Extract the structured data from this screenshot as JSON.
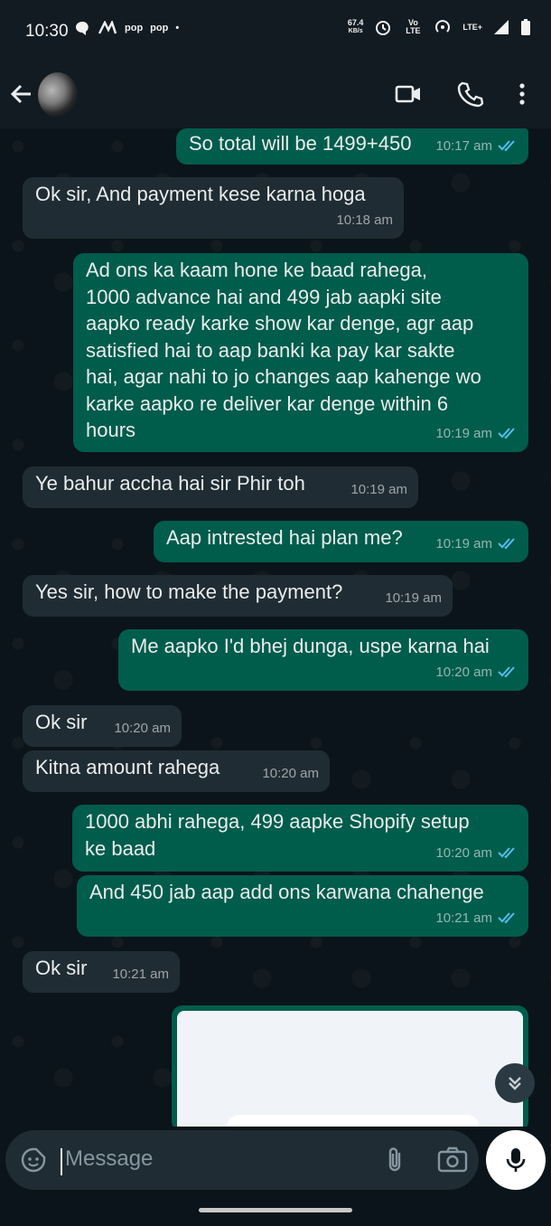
{
  "status_bar": {
    "time": "10:30",
    "badges": [
      "pop",
      "pop"
    ],
    "speed_value": "67.4",
    "speed_unit": "KB/s",
    "volte": "Vo LTE",
    "network": "LTE+"
  },
  "header": {
    "back_icon": "arrow-left-icon",
    "avatar_icon": "contact-avatar",
    "video_icon": "video-call-icon",
    "call_icon": "phone-icon",
    "menu_icon": "more-vert-icon"
  },
  "messages": [
    {
      "dir": "out",
      "text": "So total will be 1499+450",
      "time": "10:17 am",
      "read": true
    },
    {
      "dir": "in",
      "text": "Ok sir, And payment kese karna hoga",
      "time": "10:18 am"
    },
    {
      "dir": "out",
      "text": "Ad ons ka kaam hone ke baad rahega,\n1000 advance hai and 499 jab aapki site\naapko ready karke show kar denge, agr aap\nsatisfied hai to aap banki ka pay kar sakte\nhai, agar nahi to jo changes aap kahenge wo\nkarke aapko re deliver kar denge within 6\nhours",
      "time": "10:19 am",
      "read": true
    },
    {
      "dir": "in",
      "text": "Ye bahur accha hai sir Phir toh",
      "time": "10:19 am"
    },
    {
      "dir": "out",
      "text": "Aap intrested hai plan me?",
      "time": "10:19 am",
      "read": true
    },
    {
      "dir": "in",
      "text": "Yes sir, how to make the payment?",
      "time": "10:19 am"
    },
    {
      "dir": "out",
      "text": "Me aapko I'd bhej dunga, uspe karna hai",
      "time": "10:20 am",
      "read": true
    },
    {
      "dir": "in",
      "text": "Ok sir",
      "time": "10:20 am"
    },
    {
      "dir": "in",
      "text": "Kitna amount rahega",
      "time": "10:20 am"
    },
    {
      "dir": "out",
      "text": "1000 abhi rahega, 499 aapke Shopify setup\nke baad",
      "time": "10:20 am",
      "read": true
    },
    {
      "dir": "out",
      "text": "And 450 jab aap add ons karwana chahenge",
      "time": "10:21 am",
      "read": true
    },
    {
      "dir": "in",
      "text": "Ok sir",
      "time": "10:21 am"
    }
  ],
  "composer": {
    "placeholder": "Message",
    "emoji_icon": "sticker-icon",
    "attach_icon": "paperclip-icon",
    "camera_icon": "camera-icon",
    "mic_icon": "microphone-icon"
  },
  "colors": {
    "incoming_bubble": "#202c33",
    "outgoing_bubble": "#005c4b",
    "read_ticks": "#53bdeb",
    "background": "#0b141a"
  }
}
